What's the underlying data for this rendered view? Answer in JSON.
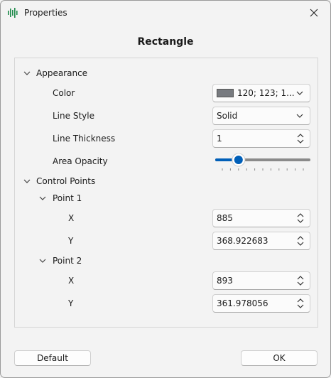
{
  "window": {
    "title": "Properties"
  },
  "heading": "Rectangle",
  "appearance": {
    "label": "Appearance",
    "color": {
      "label": "Color",
      "value": "120; 123; 1...",
      "swatch": "#787b80"
    },
    "line_style": {
      "label": "Line Style",
      "value": "Solid"
    },
    "line_thickness": {
      "label": "Line Thickness",
      "value": "1"
    },
    "area_opacity": {
      "label": "Area Opacity",
      "value_fraction": 0.2
    }
  },
  "control_points": {
    "label": "Control Points",
    "point1": {
      "label": "Point 1",
      "x_label": "X",
      "x": "885",
      "y_label": "Y",
      "y": "368.922683"
    },
    "point2": {
      "label": "Point 2",
      "x_label": "X",
      "x": "893",
      "y_label": "Y",
      "y": "361.978056"
    }
  },
  "buttons": {
    "default": "Default",
    "ok": "OK"
  },
  "colors": {
    "accent": "#005fb8",
    "panel_border": "#d5d5d5"
  }
}
